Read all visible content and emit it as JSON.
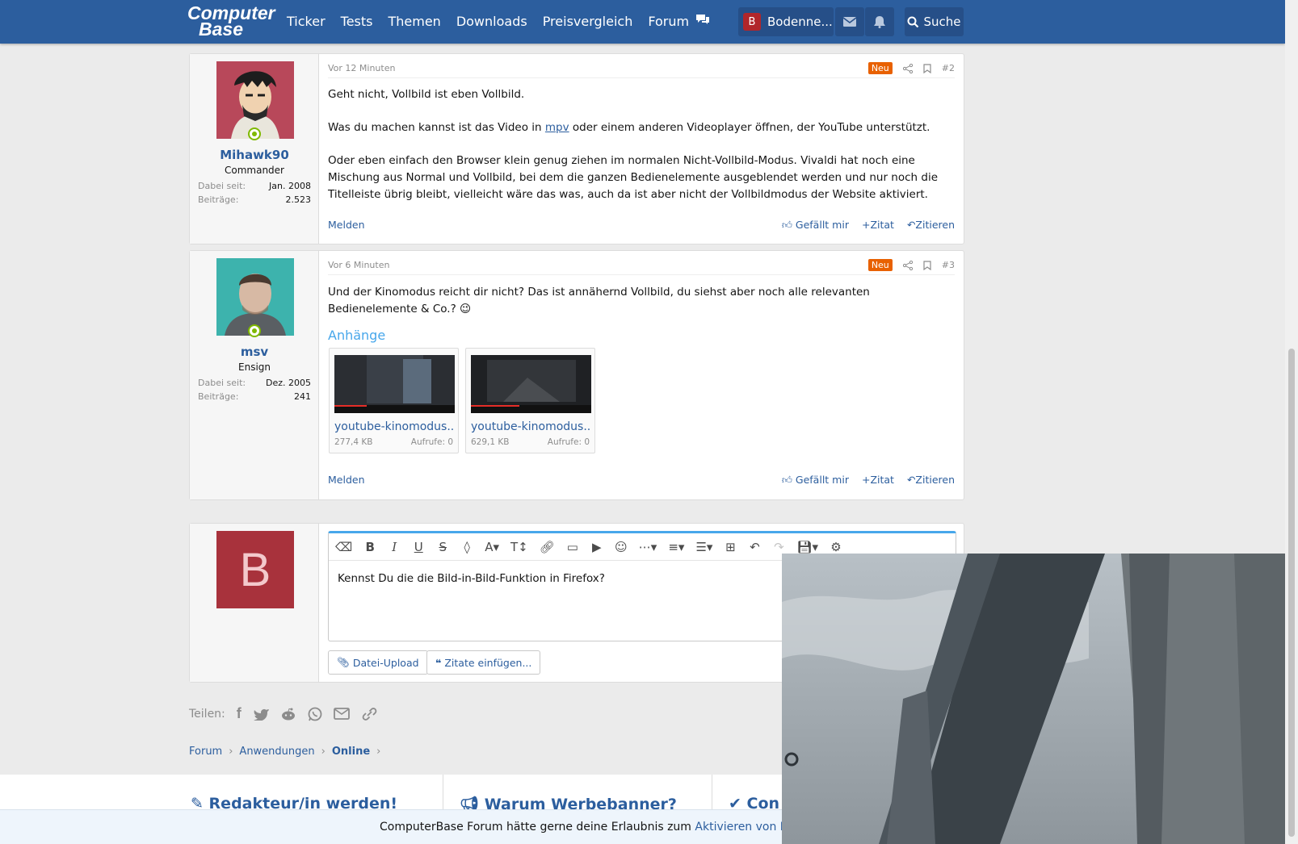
{
  "header": {
    "logo_line1": "Computer",
    "logo_line2": "Base",
    "nav": [
      "Ticker",
      "Tests",
      "Themen",
      "Downloads",
      "Preisvergleich",
      "Forum"
    ],
    "user_initial": "B",
    "user_name": "Bodenne...",
    "search_label": "Suche"
  },
  "posts": [
    {
      "user": "Mihawk90",
      "role": "Commander",
      "meta": [
        {
          "k": "Dabei seit:",
          "v": "Jan. 2008"
        },
        {
          "k": "Beiträge:",
          "v": "2.523"
        }
      ],
      "time": "Vor 12 Minuten",
      "badge": "Neu",
      "num": "#2",
      "p1": "Geht nicht, Vollbild ist eben Vollbild.",
      "p2_pre": "Was du machen kannst ist das Video in ",
      "p2_link": "mpv",
      "p2_post": " oder einem anderen Videoplayer öffnen, der YouTube unterstützt.",
      "p3": "Oder eben einfach den Browser klein genug ziehen im normalen Nicht-Vollbild-Modus. Vivaldi hat noch eine Mischung aus Normal und Vollbild, bei dem die ganzen Bedienelemente ausgeblendet werden und nur noch die Titelleiste übrig bleibt, vielleicht wäre das was, auch da ist aber nicht der Vollbildmodus der Website aktiviert."
    },
    {
      "user": "msv",
      "role": "Ensign",
      "meta": [
        {
          "k": "Dabei seit:",
          "v": "Dez. 2005"
        },
        {
          "k": "Beiträge:",
          "v": "241"
        }
      ],
      "time": "Vor 6 Minuten",
      "badge": "Neu",
      "num": "#3",
      "p1": "Und der Kinomodus reicht dir nicht? Das ist annähernd Vollbild, du siehst aber noch alle relevanten Bedienelemente & Co.? 😉",
      "attachments_title": "Anhänge",
      "attachments": [
        {
          "name": "youtube-kinomodus...",
          "size": "277,4 KB",
          "views": "Aufrufe: 0"
        },
        {
          "name": "youtube-kinomodus...",
          "size": "629,1 KB",
          "views": "Aufrufe: 0"
        }
      ]
    }
  ],
  "footer_actions": {
    "report": "Melden",
    "like": "Gefällt mir",
    "quote": "Zitat",
    "reply": "Zitieren"
  },
  "reply": {
    "avatar_initial": "B",
    "text": "Kennst Du die die Bild-in-Bild-Funktion in Firefox?",
    "upload": "Datei-Upload",
    "insert_quotes": "Zitate einfügen..."
  },
  "share_label": "Teilen:",
  "breadcrumb": [
    "Forum",
    "Anwendungen",
    "Online"
  ],
  "promos": [
    "Redakteur/in werden!",
    "Warum Werbebanner?",
    "Con"
  ],
  "push": {
    "text": "ComputerBase Forum hätte gerne deine Erlaubnis zum ",
    "link": "Aktivieren von Push-"
  },
  "colors": {
    "brand": "#2c5e9e",
    "badge": "#e86100",
    "online": "#7fb900"
  }
}
